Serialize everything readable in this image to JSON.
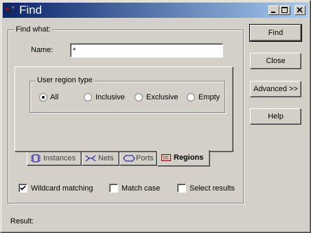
{
  "window": {
    "title": "Find",
    "minimize_label": "minimize",
    "maximize_label": "maximize",
    "close_label": "close"
  },
  "find_what": {
    "label": "Find what:",
    "name_label": "Name:",
    "name_value": "*",
    "region_group": {
      "label": "User region type",
      "options": [
        "All",
        "Inclusive",
        "Exclusive",
        "Empty"
      ],
      "selected": "All"
    }
  },
  "tabs": [
    {
      "label": "Instances",
      "icon": "instances-icon",
      "active": false
    },
    {
      "label": "Nets",
      "icon": "nets-icon",
      "active": false
    },
    {
      "label": "Ports",
      "icon": "ports-icon",
      "active": false
    },
    {
      "label": "Regions",
      "icon": "regions-icon",
      "active": true
    }
  ],
  "options": {
    "wildcard": {
      "label": "Wildcard matching",
      "checked": true
    },
    "match_case": {
      "label": "Match case",
      "checked": false
    },
    "select_results": {
      "label": "Select results",
      "checked": false
    }
  },
  "buttons": {
    "find": "Find",
    "close": "Close",
    "advanced": "Advanced >>",
    "help": "Help"
  },
  "result_label": "Result:",
  "colors": {
    "title_start": "#0a246a",
    "title_end": "#a6caf0",
    "face": "#d4d0c8"
  }
}
